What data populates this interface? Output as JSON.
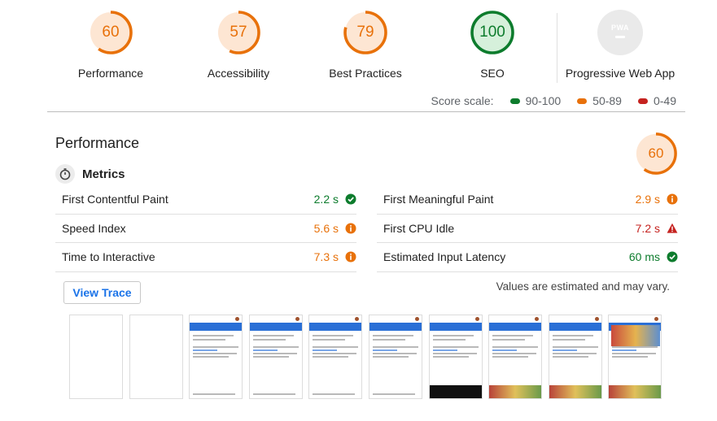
{
  "categories": [
    {
      "label": "Performance",
      "score": "60",
      "value": 60,
      "color": "#e8710a",
      "track": "#fde6d3"
    },
    {
      "label": "Accessibility",
      "score": "57",
      "value": 57,
      "color": "#e8710a",
      "track": "#fde6d3"
    },
    {
      "label": "Best Practices",
      "score": "79",
      "value": 79,
      "color": "#e8710a",
      "track": "#fde6d3"
    },
    {
      "label": "SEO",
      "score": "100",
      "value": 100,
      "color": "#0d7c2d",
      "track": "#d6f0db"
    },
    {
      "label": "Progressive Web App",
      "badge": "PWA",
      "icon": "pwa-badge-icon"
    }
  ],
  "score_scale": {
    "label": "Score scale:",
    "ranges": [
      {
        "text": "90-100",
        "color": "#0d7c2d"
      },
      {
        "text": "50-89",
        "color": "#e8710a"
      },
      {
        "text": "0-49",
        "color": "#c5221f"
      }
    ]
  },
  "performance": {
    "title": "Performance",
    "score": "60",
    "value": 60,
    "metrics_title": "Metrics",
    "metrics_left": [
      {
        "name": "First Contentful Paint",
        "value": "2.2 s",
        "status": "pass"
      },
      {
        "name": "Speed Index",
        "value": "5.6 s",
        "status": "average"
      },
      {
        "name": "Time to Interactive",
        "value": "7.3 s",
        "status": "average"
      }
    ],
    "metrics_right": [
      {
        "name": "First Meaningful Paint",
        "value": "2.9 s",
        "status": "average"
      },
      {
        "name": "First CPU Idle",
        "value": "7.2 s",
        "status": "fail"
      },
      {
        "name": "Estimated Input Latency",
        "value": "60 ms",
        "status": "pass"
      }
    ],
    "view_trace": "View Trace",
    "note": "Values are estimated and may vary.",
    "filmstrip_frames": 10
  }
}
